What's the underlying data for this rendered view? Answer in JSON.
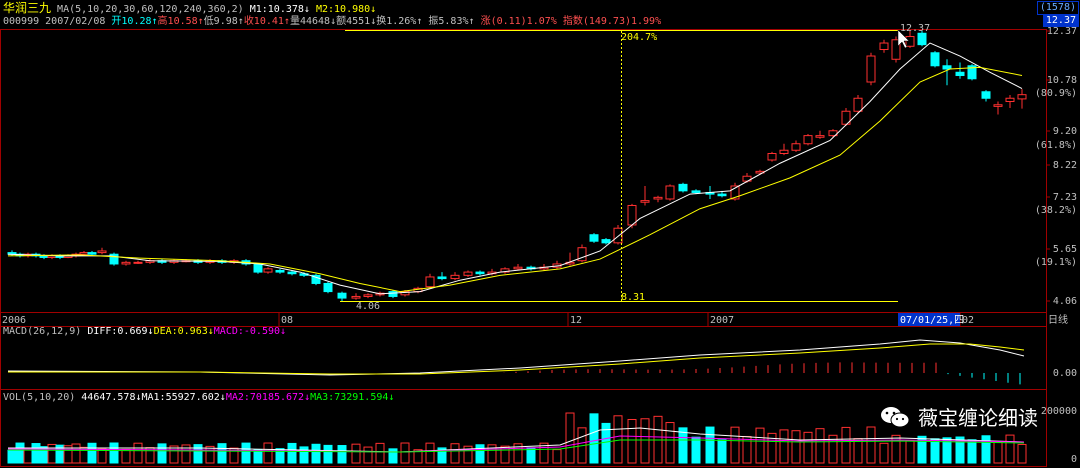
{
  "header": {
    "stock_name": "华润三九",
    "ma_label": "MA(5,10,20,30,60,120,240,360,2)",
    "m1_label": "M1:10.378",
    "m2_label": "M2:10.980",
    "stock_code": "000999",
    "date": "2007/02/08",
    "open_label": "开10.28",
    "high_label": "高10.58",
    "low_label": "低9.98",
    "close_label": "收10.41",
    "volume_label": "量44648",
    "amount_label": "额4551",
    "turnover_label": "换1.26%",
    "amplitude_label": "振5.83%",
    "change_prefix": "涨",
    "change_value": "(0.11)1.07%",
    "index_prefix": "指数",
    "index_value": "(149.73)1.99%",
    "code_box": "(1578)",
    "price_box": "12.37"
  },
  "price_axis": [
    {
      "value": "12.37",
      "pct": ""
    },
    {
      "value": "10.78",
      "pct": "(80.9%)"
    },
    {
      "value": "9.20",
      "pct": "(61.8%)"
    },
    {
      "value": "8.22",
      "pct": ""
    },
    {
      "value": "7.23",
      "pct": "(38.2%)"
    },
    {
      "value": "5.65",
      "pct": "(19.1%)"
    },
    {
      "value": "4.06",
      "pct": ""
    }
  ],
  "annotations": {
    "high_price": "12.37",
    "low_price": "4.06",
    "range_pct": "204.7%",
    "measure_price": "8.31",
    "cursor_date": "07/01/25,四"
  },
  "time_axis": [
    "2006",
    "08",
    "12",
    "2007",
    "02"
  ],
  "period_label": "日线",
  "macd": {
    "title": "MACD(26,12,9)",
    "diff": "DIFF:0.669",
    "dea": "DEA:0.963",
    "macd": "MACD:-0.590",
    "axis_value": "0.00"
  },
  "vol": {
    "title": "VOL(5,10,20)",
    "value": "44647.578",
    "ma1": "MA1:55927.602",
    "ma2": "MA2:70185.672",
    "ma3": "MA3:73291.594",
    "axis_top": "200000",
    "axis_bottom": "0"
  },
  "watermark": "薇宝缠论细读",
  "colors": {
    "up": "#ff3030",
    "down": "#00ffff",
    "ma1": "#ffffff",
    "ma2": "#ffff00",
    "grid": "#a00000"
  }
}
